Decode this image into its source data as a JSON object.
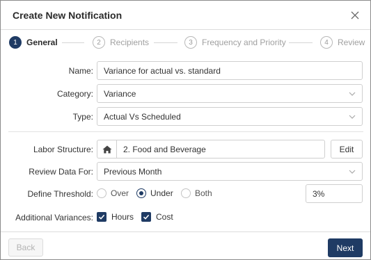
{
  "dialog": {
    "title": "Create New Notification"
  },
  "stepper": {
    "steps": [
      {
        "num": "1",
        "label": "General"
      },
      {
        "num": "2",
        "label": "Recipients"
      },
      {
        "num": "3",
        "label": "Frequency and Priority"
      },
      {
        "num": "4",
        "label": "Review"
      }
    ],
    "active_step": 1
  },
  "form": {
    "name": {
      "label": "Name:",
      "value": "Variance for actual vs. standard"
    },
    "category": {
      "label": "Category:",
      "value": "Variance"
    },
    "type": {
      "label": "Type:",
      "value": "Actual Vs Scheduled"
    },
    "labor_structure": {
      "label": "Labor Structure:",
      "value": "2. Food and Beverage",
      "edit_label": "Edit",
      "icon": "home-icon"
    },
    "review_data_for": {
      "label": "Review Data For:",
      "value": "Previous Month"
    },
    "define_threshold": {
      "label": "Define Threshold:",
      "options": [
        "Over",
        "Under",
        "Both"
      ],
      "selected": "Under",
      "value": "3%"
    },
    "additional_variances": {
      "label": "Additional Variances:",
      "options": [
        {
          "label": "Hours",
          "checked": true
        },
        {
          "label": "Cost",
          "checked": true
        }
      ]
    }
  },
  "footer": {
    "back_label": "Back",
    "next_label": "Next"
  },
  "colors": {
    "primary": "#1f3b64",
    "border": "#cfcfcf",
    "muted_text": "#a0a0a0"
  }
}
